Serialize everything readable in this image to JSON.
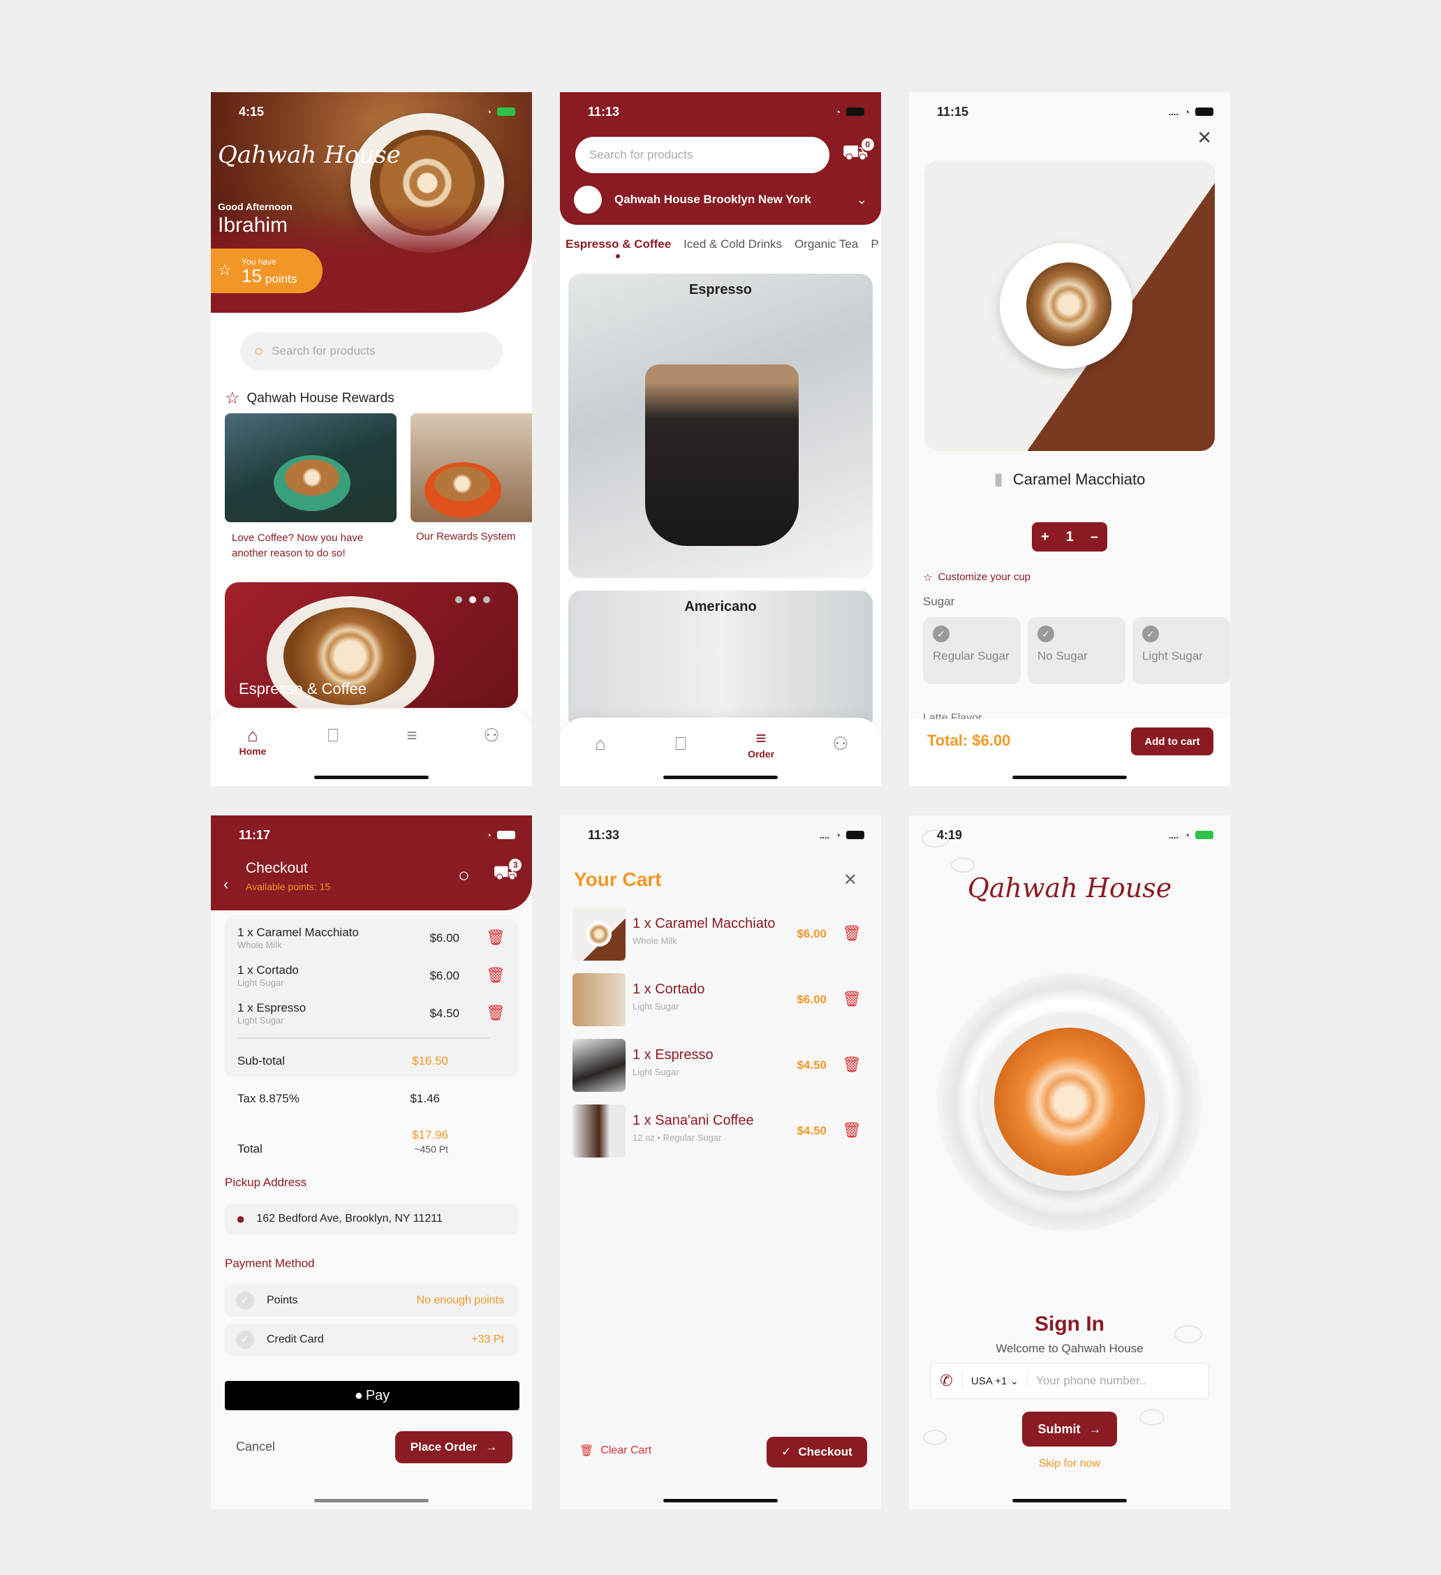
{
  "colors": {
    "maroon": "#8a1b22",
    "orange": "#f29727",
    "bg": "#efefef"
  },
  "screen_home": {
    "time": "4:15",
    "logo": "Qahwah House",
    "greeting": "Good Afternoon",
    "user_name": "Ibrahim",
    "points_prefix": "You have",
    "points_value": "15",
    "points_unit": "points",
    "search_placeholder": "Search for products",
    "rewards_title": "Qahwah House Rewards",
    "cards": [
      {
        "caption": "Love Coffee? Now you have another reason to do so!"
      },
      {
        "caption": "Our Rewards System"
      }
    ],
    "banner_title": "Espresso & Coffee",
    "tabs": [
      {
        "label": "Home",
        "icon": "home-icon"
      },
      {
        "label": "",
        "icon": "bookmark-icon"
      },
      {
        "label": "",
        "icon": "order-icon"
      },
      {
        "label": "",
        "icon": "profile-icon"
      }
    ]
  },
  "screen_menu": {
    "time": "11:13",
    "search_placeholder": "Search for products",
    "cart_count": "0",
    "store": "Qahwah House Brooklyn New York",
    "categories": [
      "Espresso & Coffee",
      "Iced & Cold Drinks",
      "Organic Tea",
      "P"
    ],
    "products": [
      "Espresso",
      "Americano"
    ],
    "tabs": [
      {
        "label": "",
        "icon": "home-icon"
      },
      {
        "label": "",
        "icon": "bookmark-icon"
      },
      {
        "label": "Order",
        "icon": "order-icon"
      },
      {
        "label": "",
        "icon": "profile-icon"
      }
    ]
  },
  "screen_product": {
    "time": "11:15",
    "name": "Caramel Macchiato",
    "quantity": "1",
    "customize": "Customize your cup",
    "sugar_label": "Sugar",
    "sugar_options": [
      "Regular Sugar",
      "No Sugar",
      "Light Sugar"
    ],
    "next_section": "Latte Flavor",
    "total": "Total: $6.00",
    "add_to_cart": "Add to cart"
  },
  "screen_checkout": {
    "time": "11:17",
    "title": "Checkout",
    "available_points": "Available points: 15",
    "cart_count": "3",
    "items": [
      {
        "name": "1 x Caramel Macchiato",
        "sub": "Whole Milk",
        "price": "$6.00"
      },
      {
        "name": "1 x Cortado",
        "sub": "Light Sugar",
        "price": "$6.00"
      },
      {
        "name": "1 x Espresso",
        "sub": "Light Sugar",
        "price": "$4.50"
      }
    ],
    "subtotal_label": "Sub-total",
    "subtotal": "$16.50",
    "tax_label": "Tax 8.875%",
    "tax": "$1.46",
    "total_label": "Total",
    "total": "$17.96",
    "total_points": "~450 Pt",
    "pickup_label": "Pickup Address",
    "address": "162 Bedford Ave, Brooklyn, NY 11211",
    "payment_label": "Payment Method",
    "payments": [
      {
        "name": "Points",
        "note": "No enough points"
      },
      {
        "name": "Credit Card",
        "note": "+33 Pt"
      }
    ],
    "apple_pay": "Pay",
    "cancel": "Cancel",
    "place_order": "Place Order"
  },
  "screen_cart": {
    "time": "11:33",
    "title": "Your Cart",
    "items": [
      {
        "name": "1 x Caramel Macchiato",
        "sub": "Whole Milk",
        "price": "$6.00"
      },
      {
        "name": "1 x Cortado",
        "sub": "Light Sugar",
        "price": "$6.00"
      },
      {
        "name": "1 x Espresso",
        "sub": "Light Sugar",
        "price": "$4.50"
      },
      {
        "name": "1 x Sana'ani Coffee",
        "sub": "12 oz  •  Regular Sugar",
        "price": "$4.50"
      }
    ],
    "clear": "Clear Cart",
    "checkout": "Checkout"
  },
  "screen_signin": {
    "time": "4:19",
    "logo": "Qahwah House",
    "title": "Sign In",
    "subtitle": "Welcome to Qahwah House",
    "country": "USA +1",
    "phone_placeholder": "Your phone number..",
    "submit": "Submit",
    "skip": "Skip for now"
  }
}
